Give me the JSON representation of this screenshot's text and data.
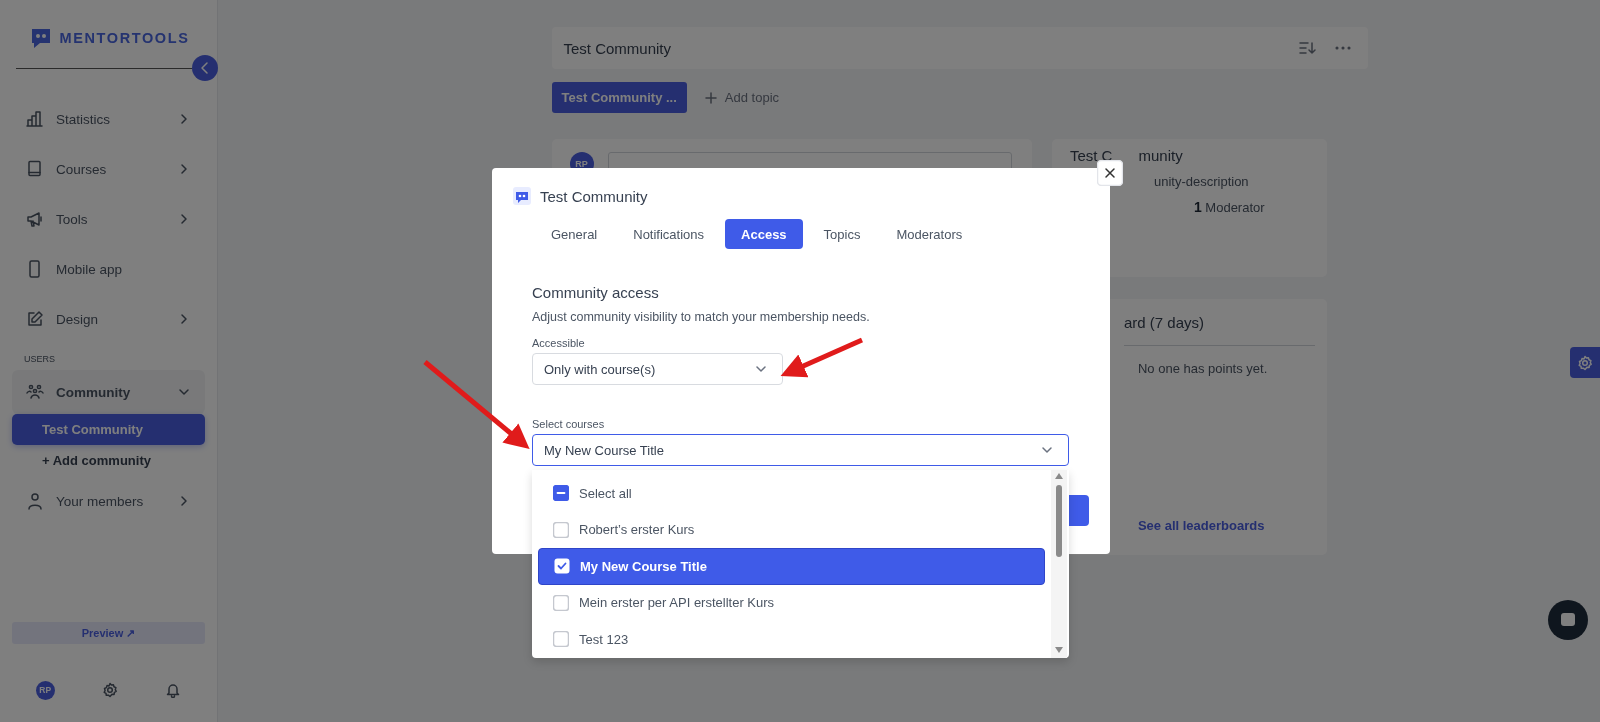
{
  "sidebar": {
    "logo": "MENTORTOOLS",
    "items": [
      {
        "kind": "group",
        "label": "Statistics",
        "expanded": false,
        "selected": false
      },
      {
        "kind": "group",
        "label": "Courses",
        "expanded": false,
        "selected": false
      },
      {
        "kind": "group",
        "label": "Tools",
        "expanded": false,
        "selected": false
      },
      {
        "kind": "link",
        "label": "Mobile app",
        "selected": false
      },
      {
        "kind": "group",
        "label": "Design",
        "expanded": false,
        "selected": false
      },
      {
        "kind": "section",
        "label": "USERS"
      },
      {
        "kind": "group",
        "label": "Community",
        "expanded": true,
        "selected": true,
        "children": [
          {
            "label": "Test Community",
            "selected": true
          },
          {
            "label": "+ Add community",
            "selected": false
          }
        ]
      },
      {
        "kind": "group",
        "label": "Your members",
        "expanded": false,
        "selected": false
      }
    ],
    "preview": "Preview ↗",
    "avatar": "RP"
  },
  "header": {
    "title": "Test Community"
  },
  "topics": {
    "chips": [
      "Test Community ..."
    ],
    "add": "Add topic"
  },
  "composer": {
    "avatar": "RP"
  },
  "info_card": {
    "title": "Test C",
    "title_end": "munity",
    "description": "unity-description",
    "count": "1",
    "count_label": "Moderator"
  },
  "leaderboard": {
    "title": "ard (7 days)",
    "empty": "No one has points yet.",
    "link": "See all leaderboards"
  },
  "modal": {
    "title": "Test Community",
    "tabs": [
      {
        "label": "General",
        "selected": false
      },
      {
        "label": "Notifications",
        "selected": false
      },
      {
        "label": "Access",
        "selected": true
      },
      {
        "label": "Topics",
        "selected": false
      },
      {
        "label": "Moderators",
        "selected": false
      }
    ],
    "heading": "Community access",
    "description": "Adjust community visibility to match your membership needs.",
    "accessible": {
      "label": "Accessible",
      "value": "Only with course(s)"
    },
    "courses": {
      "label": "Select courses",
      "value": "My New Course Title",
      "expanded": true,
      "select_all": {
        "label": "Select all",
        "indeterminate": true
      },
      "options": [
        {
          "label": "Robert’s erster Kurs",
          "selected": false
        },
        {
          "label": "My New Course Title",
          "selected": true
        },
        {
          "label": "Mein erster per API erstellter Kurs",
          "selected": false
        },
        {
          "label": "Test 123",
          "selected": false
        }
      ]
    }
  }
}
